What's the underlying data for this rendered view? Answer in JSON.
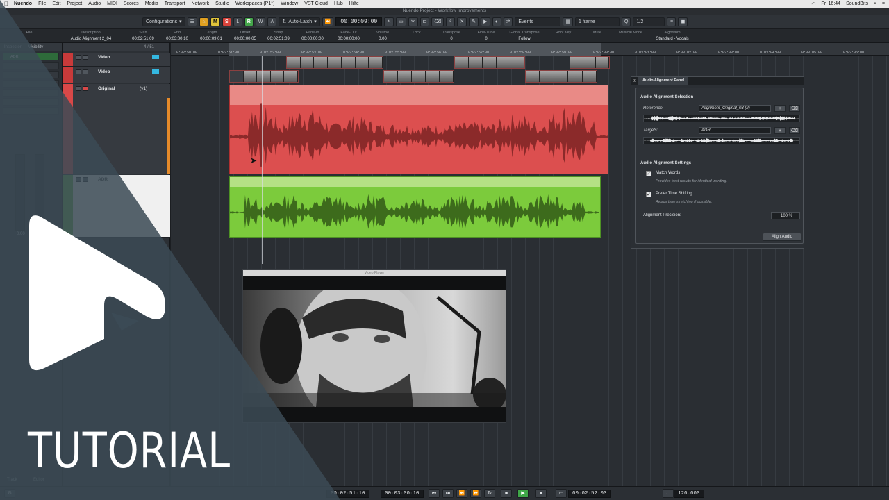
{
  "menubar": {
    "apple": "",
    "app": "Nuendo",
    "items": [
      "File",
      "Edit",
      "Project",
      "Audio",
      "MIDI",
      "Scores",
      "Media",
      "Transport",
      "Network",
      "Studio",
      "Workspaces (P1*)",
      "Window",
      "VST Cloud",
      "Hub",
      "Hilfe"
    ],
    "clock": "Fr. 16:44",
    "user": "SoundBits"
  },
  "window": {
    "title": "Nuendo Project - Workflow Improvements"
  },
  "toolbar": {
    "configurations": "Configurations",
    "m": "M",
    "s": "S",
    "l": "L",
    "r": "R",
    "w": "W",
    "a": "A",
    "automation_mode": "Auto-Latch",
    "time": "00:00:09:00",
    "events": "Events",
    "nudge": "1 frame",
    "quantize": "1/2"
  },
  "infoline": {
    "columns": [
      {
        "label": "File",
        "value": ""
      },
      {
        "label": "Description",
        "value": "Audio Alignment 2_04"
      },
      {
        "label": "Start",
        "value": "00:02:51:09"
      },
      {
        "label": "End",
        "value": "00:03:00:10"
      },
      {
        "label": "Length",
        "value": "00:00:09:01"
      },
      {
        "label": "Offset",
        "value": "00:00:00:05"
      },
      {
        "label": "Snap",
        "value": "00:02:51:09"
      },
      {
        "label": "Fade-In",
        "value": "00:00:00:00"
      },
      {
        "label": "Fade-Out",
        "value": "00:00:00:00"
      },
      {
        "label": "Volume",
        "value": "0.00"
      },
      {
        "label": "Lock",
        "value": ""
      },
      {
        "label": "Transpose",
        "value": "0"
      },
      {
        "label": "Fine-Tune",
        "value": "0"
      },
      {
        "label": "Global Transpose",
        "value": "Follow"
      },
      {
        "label": "Root Key",
        "value": ""
      },
      {
        "label": "Mute",
        "value": ""
      },
      {
        "label": "Musical Mode",
        "value": ""
      },
      {
        "label": "Algorithm",
        "value": "Standard - Vocals"
      }
    ]
  },
  "inspector": {
    "tab_inspector": "Inspector",
    "tab_visibility": "Visibility",
    "track_name": "ADR",
    "fader_value": "0.00",
    "track_tab": "Track",
    "editor_tab": "Editor"
  },
  "tracklist": {
    "counter": "4 / 51",
    "tracks": [
      {
        "name": "Video",
        "sub": ""
      },
      {
        "name": "Video",
        "sub": ""
      },
      {
        "name": "Original",
        "sub": "(v1)"
      },
      {
        "name": "ADR",
        "sub": ""
      }
    ]
  },
  "ruler": {
    "ticks": [
      "0:02:50:00",
      "0:02:51:00",
      "0:02:52:00",
      "0:02:53:00",
      "0:02:54:00",
      "0:02:55:00",
      "0:02:56:00",
      "0:02:57:00",
      "0:02:58:00",
      "0:02:59:00",
      "0:03:00:00",
      "0:03:01:00",
      "0:03:02:00",
      "0:03:03:00",
      "0:03:04:00",
      "0:03:05:00",
      "0:03:06:00"
    ]
  },
  "video_player": {
    "title": "Video Player"
  },
  "alignment_panel": {
    "tab": "Audio Alignment Panel",
    "close": "x",
    "selection_heading": "Audio Alignment Selection",
    "reference_label": "Reference:",
    "reference_value": "Alignment_Original_03 (2)",
    "targets_label": "Targets:",
    "targets_value": "ADR",
    "add": "+",
    "settings_heading": "Audio Alignment Settings",
    "match_words": "Match Words",
    "match_words_desc": "Provides best results for identical wording.",
    "prefer_time_shifting": "Prefer Time Shifting",
    "prefer_time_shifting_desc": "Avoids time stretching if possible.",
    "precision_label": "Alignment Precision:",
    "precision_value": "100 %",
    "align_button": "Align Audio",
    "check": "✓"
  },
  "transport": {
    "left_time": "00:02:51:10",
    "right_time": "00:03:00:10",
    "position": "00:02:52:03",
    "tempo": "120.000"
  },
  "branding": {
    "tutorial": "TUTORIAL"
  },
  "colors": {
    "original_event": "#dc4f4f",
    "adr_event": "#7ccb3c",
    "accent_cyan": "#34b7e0"
  }
}
